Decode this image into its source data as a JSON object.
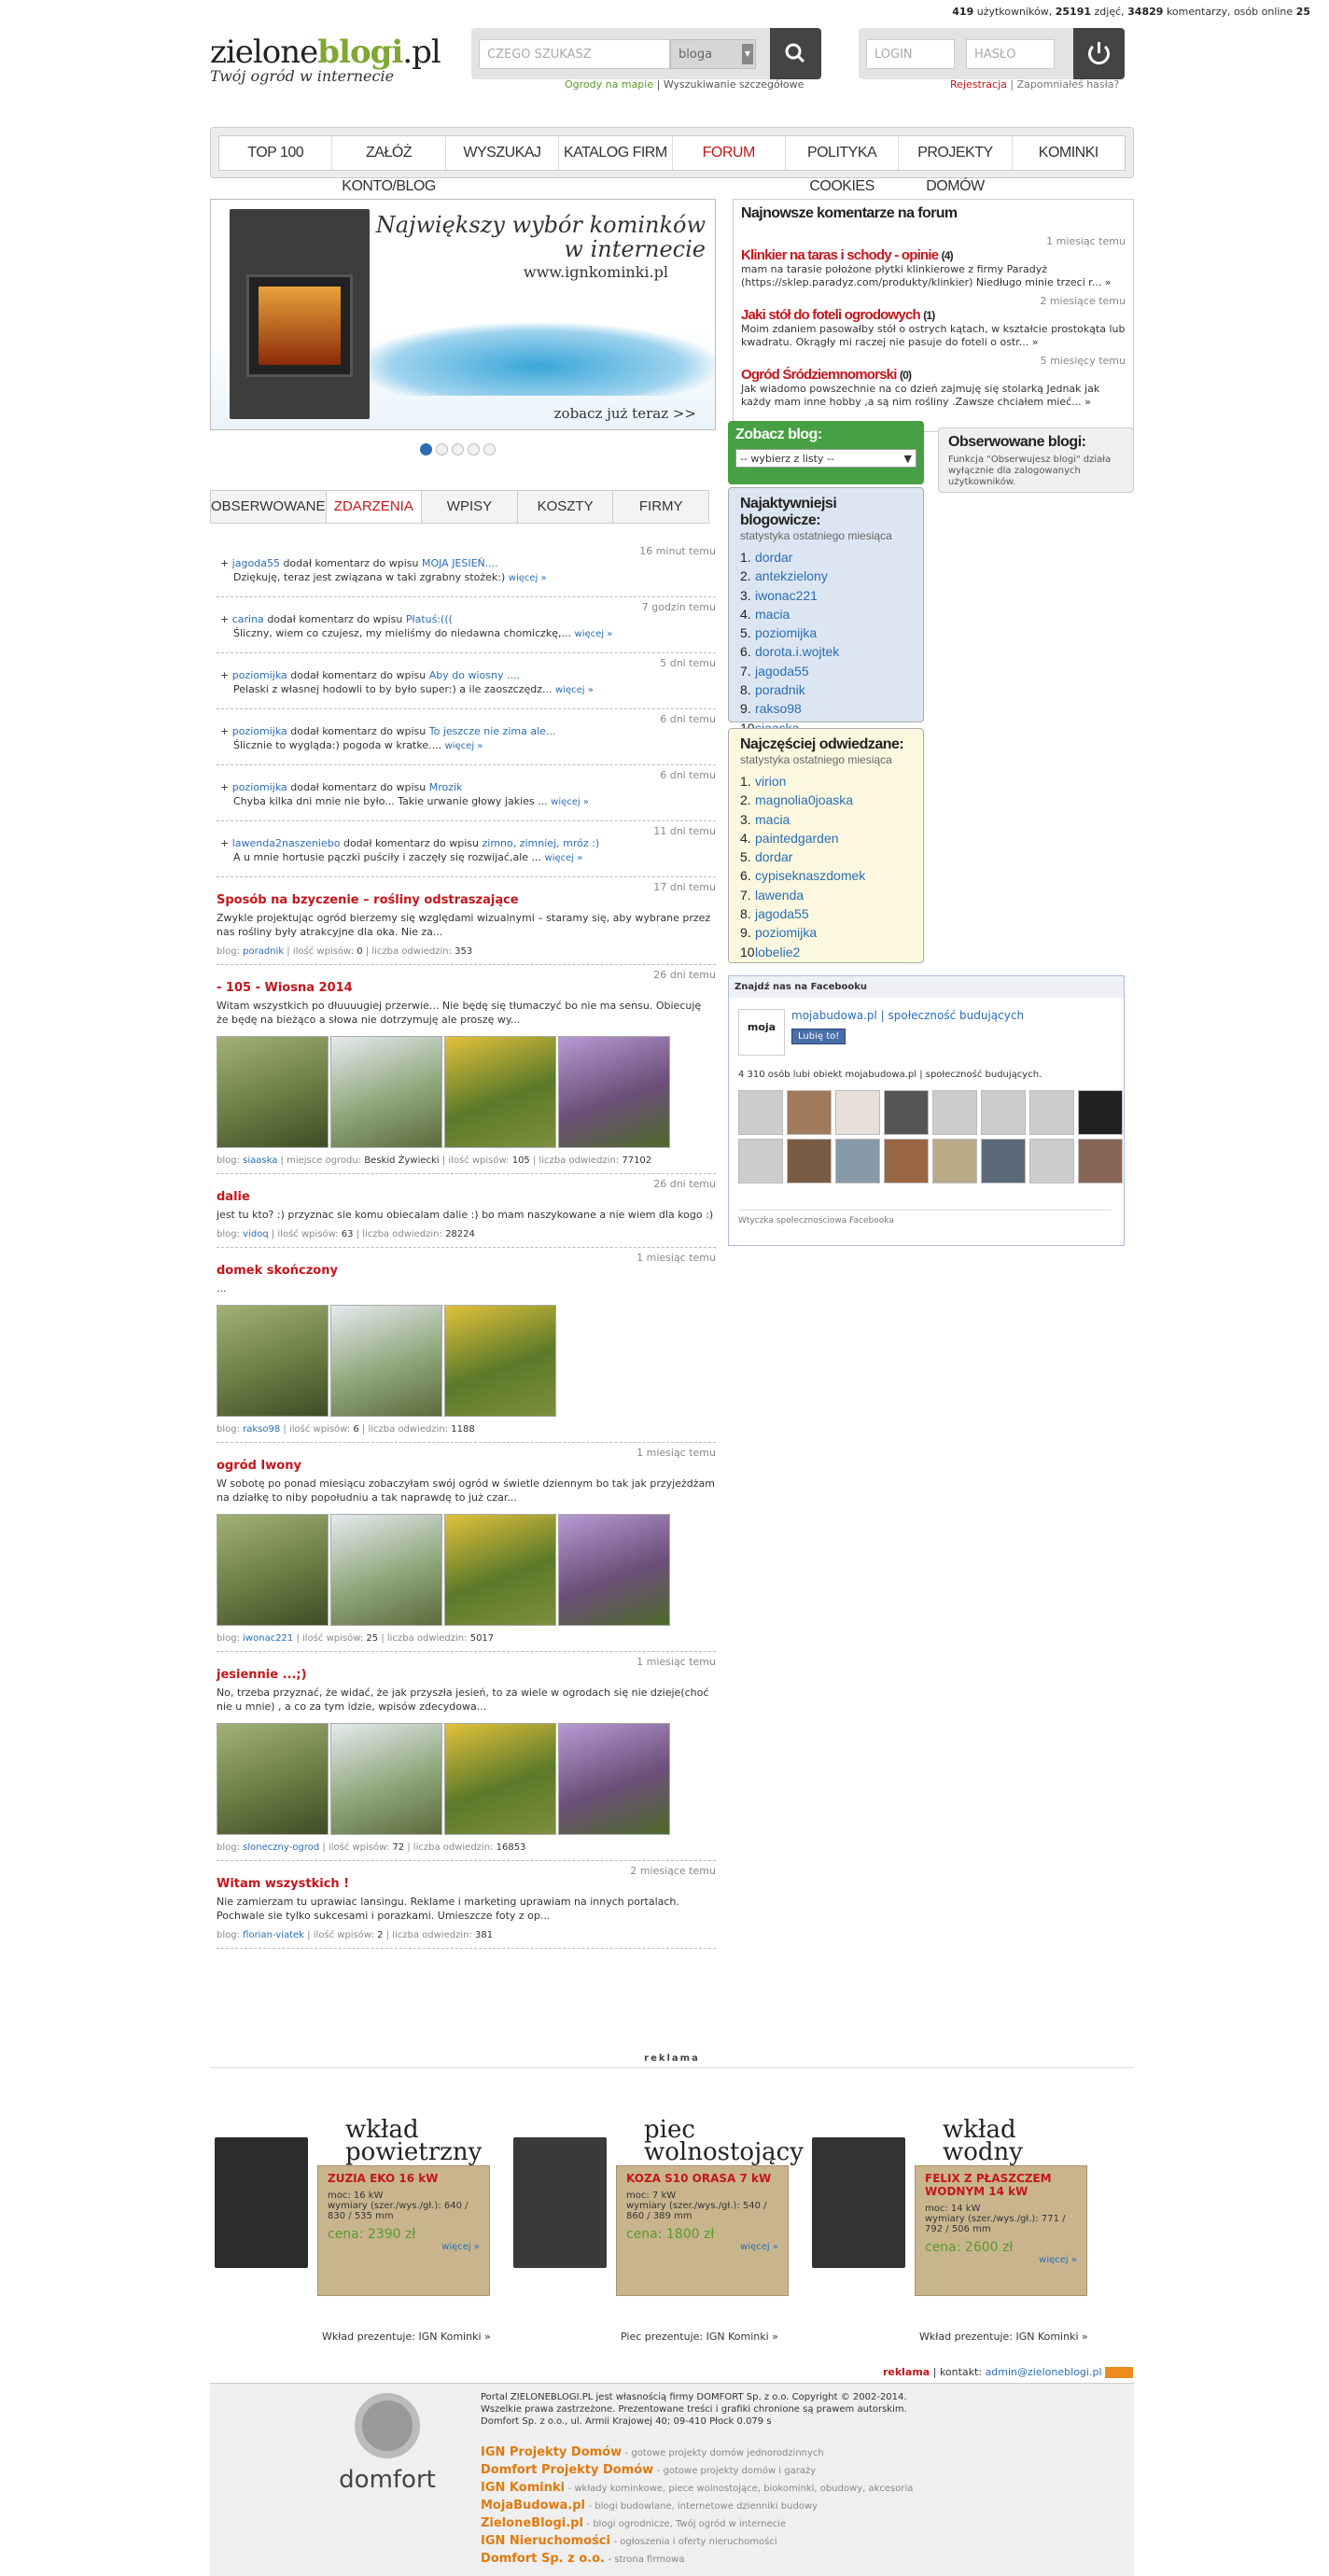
{
  "top": {
    "users": "419",
    "users_label": "użytkowników,",
    "photos": "25191",
    "photos_label": "zdjęć,",
    "comments": "34829",
    "comments_label": "komentarzy, osób online",
    "online": "25"
  },
  "logo": {
    "name_a": "zielone",
    "name_b": "blogi",
    "name_c": ".pl",
    "tagline": "Twój ogród w internecie"
  },
  "search": {
    "placeholder": "CZEGO SZUKASZ",
    "select": "bloga",
    "link1": "Ogrody na mapie",
    "link2": "Wyszukiwanie szczegółowe"
  },
  "login": {
    "login_ph": "LOGIN",
    "pass_ph": "HASŁO",
    "register": "Rejestracja",
    "forgot": "Zapomniałeś hasła?"
  },
  "nav": [
    "TOP 100",
    "ZAŁÓŻ KONTO/BLOG",
    "WYSZUKAJ",
    "KATALOG FIRM",
    "FORUM",
    "POLITYKA COOKIES",
    "PROJEKTY DOMÓW",
    "KOMINKI"
  ],
  "banner": {
    "headline1": "Największy wybór kominków",
    "headline2": "w internecie",
    "url": "www.ignkominki.pl",
    "cta": "zobacz już teraz >>"
  },
  "forum": {
    "title": "Najnowsze komentarze na forum",
    "items": [
      {
        "time": "1 miesiąc temu",
        "title": "Klinkier na taras i schody - opinie",
        "count": "(4)",
        "text": "mam na tarasie położone płytki klinkierowe z firmy Paradyż (https://sklep.paradyz.com/produkty/klinkier) Niedługo minie trzeci r... »"
      },
      {
        "time": "2 miesiące temu",
        "title": "Jaki stół do foteli ogrodowych",
        "count": "(1)",
        "text": "Moim zdaniem pasowałby stół o ostrych kątach, w kształcie prostokąta lub kwadratu. Okrągły mi raczej nie pasuje do foteli o ostr... »"
      },
      {
        "time": "5 miesięcy temu",
        "title": "Ogród Śródziemnomorski",
        "count": "(0)",
        "text": "Jak wiadomo powszechnie na co dzień zajmuję się stolarką Jednak jak każdy mam inne hobby ,a są nim rośliny .Zawsze chciałem mieć... »"
      }
    ]
  },
  "tabs": [
    "OBSERWOWANE",
    "ZDARZENIA",
    "WPISY",
    "KOSZTY",
    "FIRMY"
  ],
  "events": [
    {
      "time": "16 minut temu",
      "user": "jagoda55",
      "action": "dodał komentarz do wpisu",
      "target": "MOJA JESIEŃ....",
      "text": "Dziękuję, teraz jest związana w taki zgrabny stożek:)",
      "more": "więcej »"
    },
    {
      "time": "7 godzin temu",
      "user": "carina",
      "action": "dodał komentarz do wpisu",
      "target": "Płatuś:(((",
      "text": "Śliczny, wiem co czujesz, my mieliśmy do niedawna chomiczkę,...",
      "more": "więcej »"
    },
    {
      "time": "5 dni temu",
      "user": "poziomijka",
      "action": "dodał komentarz do wpisu",
      "target": "Aby do wiosny ....",
      "text": "Pelaski z własnej hodowli to by było super:) a ile zaoszczędz...",
      "more": "więcej »"
    },
    {
      "time": "6 dni temu",
      "user": "poziomijka",
      "action": "dodał komentarz do wpisu",
      "target": "To jeszcze nie zima ale...",
      "text": "Ślicznie to wygląda:) pogoda w kratke....",
      "more": "więcej »"
    },
    {
      "time": "6 dni temu",
      "user": "poziomijka",
      "action": "dodał komentarz do wpisu",
      "target": "Mrozik",
      "text": "Chyba kilka dni mnie nie było... Takie urwanie głowy jakies ...",
      "more": "więcej »"
    },
    {
      "time": "11 dni temu",
      "user": "lawenda2naszeniebo",
      "action": "dodał komentarz do wpisu",
      "target": "zimno, zimniej, mróz :)",
      "text": "A u mnie hortusie pączki puściły i zaczęły się rozwijać,ale ...",
      "more": "więcej »"
    }
  ],
  "posts": [
    {
      "time": "17 dni temu",
      "title": "Sposób na bzyczenie – rośliny odstraszające",
      "text": "Zwykle projektując ogród bierzemy się względami wizualnymi – staramy się, aby wybrane przez nas rośliny były atrakcyjne dla oka. Nie za...",
      "blog": "poradnik",
      "extra": "",
      "entries": "0",
      "visits": "353",
      "imgs": 0
    },
    {
      "time": "26 dni temu",
      "title": "- 105 - Wiosna 2014",
      "text": "Witam wszystkich po dłuuuugiej przerwie... Nie będę się tłumaczyć bo nie ma sensu. Obiecuję że będę na bieżąco a słowa nie dotrzymuję ale proszę wy...",
      "blog": "siaaska",
      "extra": "Beskid Żywiecki",
      "entries": "105",
      "visits": "77102",
      "imgs": 4
    },
    {
      "time": "26 dni temu",
      "title": "dalie",
      "text": "jest tu kto? :) przyznac sie komu obiecalam dalie :) bo mam naszykowane a nie wiem dla kogo :)",
      "blog": "vidoq",
      "extra": "",
      "entries": "63",
      "visits": "28224",
      "imgs": 0
    },
    {
      "time": "1 miesiąc temu",
      "title": "domek skończony",
      "text": "...",
      "blog": "rakso98",
      "extra": "",
      "entries": "6",
      "visits": "1188",
      "imgs": 3
    },
    {
      "time": "1 miesiąc temu",
      "title": "ogród Iwony",
      "text": "W sobotę po ponad miesiącu zobaczyłam swój ogród w świetle dziennym bo tak jak przyjeżdżam na działkę to niby popołudniu a tak naprawdę to już czar...",
      "blog": "iwonac221",
      "extra": "",
      "entries": "25",
      "visits": "5017",
      "imgs": 4
    },
    {
      "time": "1 miesiąc temu",
      "title": "jesiennie ...;)",
      "text": "No, trzeba przyznać, że widać, że jak przyszła jesień, to za wiele w ogrodach się nie dzieje(choć nie u mnie) , a co za tym idzie, wpisów zdecydowa...",
      "blog": "sloneczny-ogrod",
      "extra": "",
      "entries": "72",
      "visits": "16853",
      "imgs": 4
    },
    {
      "time": "2 miesiące temu",
      "title": "Witam wszystkich !",
      "text": "Nie zamierzam tu uprawiac lansingu. Reklame i marketing uprawiam na innych portalach. Pochwale sie tylko sukcesami i porazkami. Umieszcze foty z op...",
      "blog": "florian-viatek",
      "extra": "",
      "entries": "2",
      "visits": "381",
      "imgs": 0
    }
  ],
  "meta": {
    "blog": "blog:",
    "place": "miejsce ogrodu:",
    "entries": "ilość wpisów:",
    "visits": "liczba odwiedzin:"
  },
  "zobacz": {
    "title": "Zobacz blog:",
    "select": "-- wybierz z listy --"
  },
  "obs": {
    "title": "Obserwowane blogi:",
    "text": "Funkcja \"Obserwujesz blogi\" działa wyłącznie dla zalogowanych użytkowników."
  },
  "rank1": {
    "title": "Najaktywniejsi blogowicze:",
    "sub": "statystyka ostatniego miesiąca",
    "items": [
      "dordar",
      "antekzielony",
      "iwonac221",
      "macia",
      "poziomijka",
      "dorota.i.wojtek",
      "jagoda55",
      "poradnik",
      "rakso98",
      "siaaska"
    ]
  },
  "rank2": {
    "title": "Najczęściej odwiedzane:",
    "sub": "statystyka ostatniego miesiąca",
    "items": [
      "virion",
      "magnolia0joaska",
      "macia",
      "paintedgarden",
      "dordar",
      "cypiseknaszdomek",
      "lawenda",
      "jagoda55",
      "poziomijka",
      "lobelie2"
    ]
  },
  "fb": {
    "header": "Znajdź nas na Facebooku",
    "page": "mojabudowa.pl | społeczność budujących",
    "like": "Lubię to!",
    "count": "4 310 osób lubi obiekt mojabudowa.pl | społeczność budujących.",
    "footer": "Wtyczka społecznościowa Facebooka"
  },
  "ads": {
    "label": "reklama",
    "items": [
      {
        "head1": "wkład",
        "head2": "powietrzny",
        "name": "ZUZIA EKO 16 kW",
        "power": "moc: 16 kW",
        "dims": "wymiary (szer./wys./gł.): 640 / 830 / 535 mm",
        "price": "cena: 2390 zł",
        "more": "więcej »",
        "foot": "Wkład prezentuje: IGN Kominki »"
      },
      {
        "head1": "piec",
        "head2": "wolnostojący",
        "name": "KOZA S10 ORASA 7 kW",
        "power": "moc: 7 kW",
        "dims": "wymiary (szer./wys./gł.): 540 / 860 / 389 mm",
        "price": "cena: 1800 zł",
        "more": "więcej »",
        "foot": "Piec prezentuje: IGN Kominki »"
      },
      {
        "head1": "wkład wodny",
        "head2": "",
        "name": "FELIX Z PŁASZCZEM WODNYM 14 kW",
        "power": "moc: 14 kW",
        "dims": "wymiary (szer./wys./gł.): 771 / 792 / 506 mm",
        "price": "cena: 2600 zł",
        "more": "więcej »",
        "foot": "Wkład prezentuje: IGN Kominki »"
      }
    ]
  },
  "footlinks": {
    "ad": "reklama",
    "contact": "kontakt:",
    "email": "admin@zieloneblogi.pl"
  },
  "footer": {
    "brand": "domfort",
    "text1": "Portal ZIELONEBLOGI.PL jest własnością firmy DOMFORT Sp. z o.o. Copyright © 2002-2014.",
    "text2": "Wszelkie prawa zastrzeżone. Prezentowane treści i grafiki chronione są prawem autorskim.",
    "text3": "Domfort Sp. z o.o., ul. Armii Krajowej 40; 09-410 Płock 0.079 s",
    "links": [
      {
        "n": "IGN Projekty Domów",
        "d": "- gotowe projekty domów jednorodzinnych"
      },
      {
        "n": "Domfort Projekty Domów",
        "d": "- gotowe projekty domów i garaży"
      },
      {
        "n": "IGN Kominki",
        "d": "- wkłady kominkowe, piece wolnostojące, biokominki, obudowy, akcesoria"
      },
      {
        "n": "MojaBudowa.pl",
        "d": "- blogi budowlane, internetowe dzienniki budowy"
      },
      {
        "n": "ZieloneBlogi.pl",
        "d": "- blogi ogrodnicze, Twój ogród w internecie"
      },
      {
        "n": "IGN Nieruchomości",
        "d": "- ogłoszenia i oferty nieruchomości"
      },
      {
        "n": "Domfort Sp. z o.o.",
        "d": "- strona firmowa"
      }
    ]
  }
}
